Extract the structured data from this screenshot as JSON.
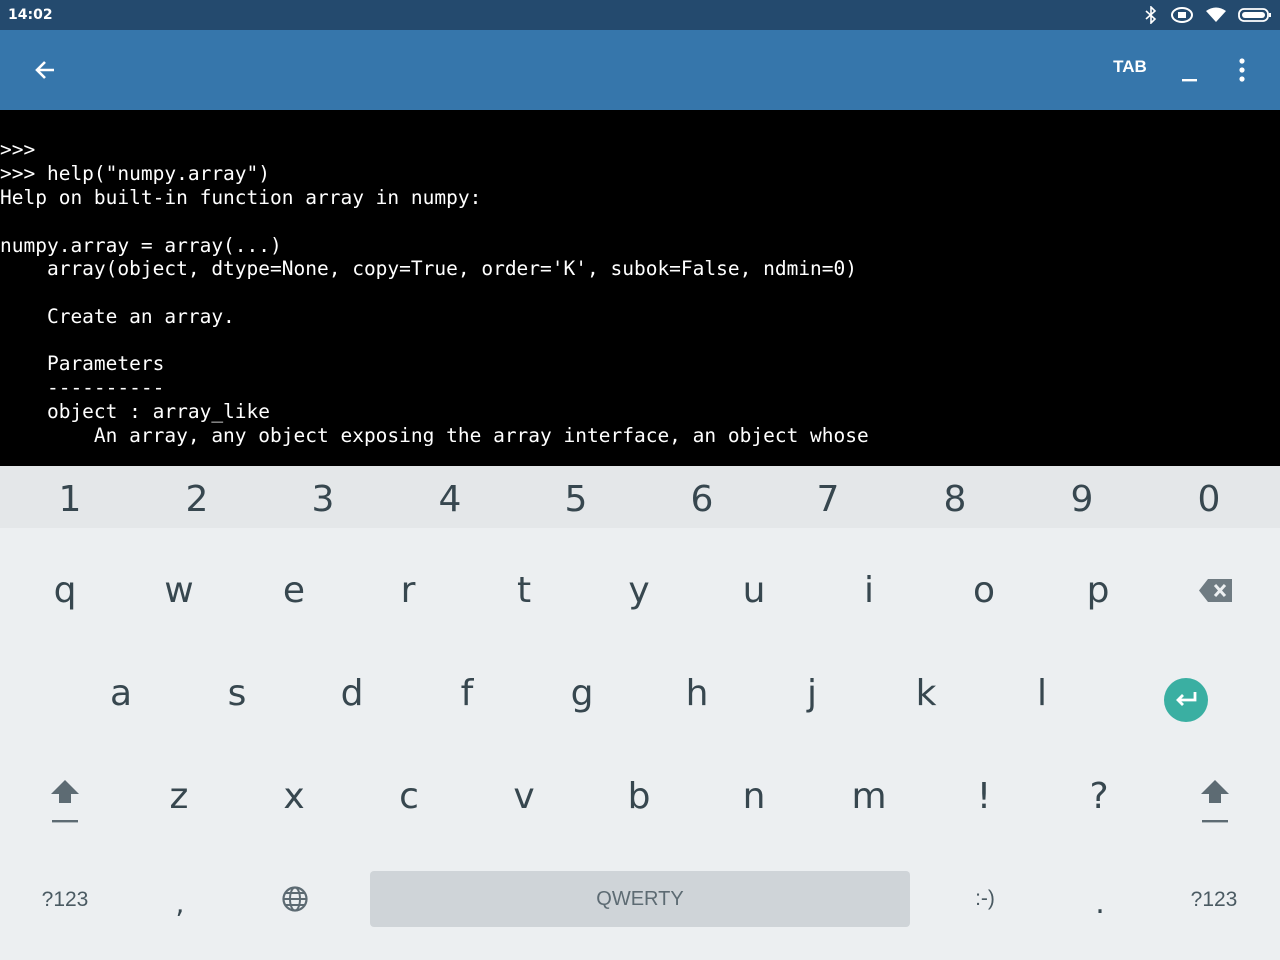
{
  "status_bar": {
    "time": "14:02"
  },
  "app_bar": {
    "tab_label": "TAB",
    "minimize_label": "_"
  },
  "terminal": {
    "lines": [
      ">>>",
      ">>> help(\"numpy.array\")",
      "Help on built-in function array in numpy:",
      "",
      "numpy.array = array(...)",
      "    array(object, dtype=None, copy=True, order='K', subok=False, ndmin=0)",
      "",
      "    Create an array.",
      "",
      "    Parameters",
      "    ----------",
      "    object : array_like",
      "        An array, any object exposing the array interface, an object whose"
    ]
  },
  "keyboard": {
    "number_row": [
      "1",
      "2",
      "3",
      "4",
      "5",
      "6",
      "7",
      "8",
      "9",
      "0"
    ],
    "row1": [
      "q",
      "w",
      "e",
      "r",
      "t",
      "y",
      "u",
      "i",
      "o",
      "p"
    ],
    "row2": [
      "a",
      "s",
      "d",
      "f",
      "g",
      "h",
      "j",
      "k",
      "l"
    ],
    "row3": [
      "z",
      "x",
      "c",
      "v",
      "b",
      "n",
      "m",
      "!",
      "?"
    ],
    "symbols_label": "?123",
    "comma": ",",
    "space_label": "QWERTY",
    "smiley": ":-)",
    "period": ".",
    "accent_color": "#3aafa2"
  }
}
